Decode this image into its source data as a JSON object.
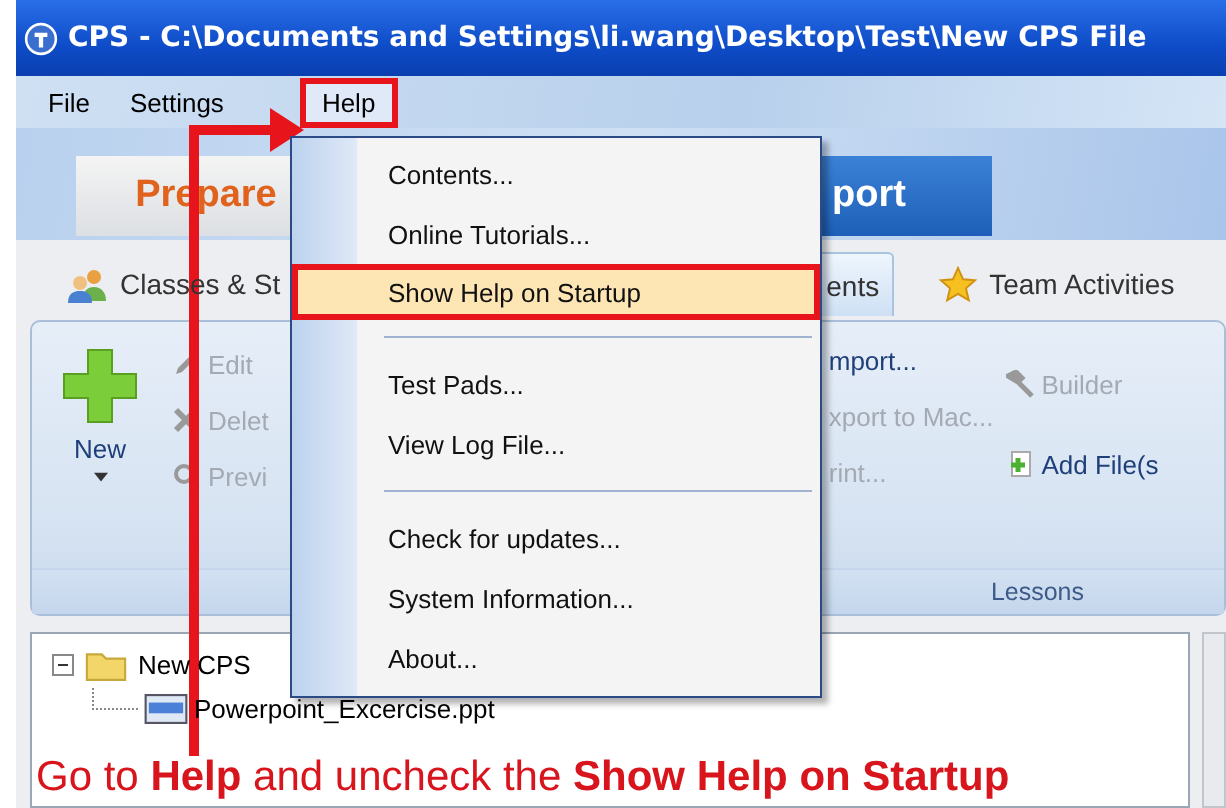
{
  "window": {
    "title": "CPS - C:\\Documents and Settings\\li.wang\\Desktop\\Test\\New CPS File"
  },
  "menu_bar": [
    {
      "label": "File",
      "selected": false
    },
    {
      "label": "Settings",
      "selected": false
    },
    {
      "label": "Help",
      "selected": true
    }
  ],
  "help_menu": [
    {
      "kind": "item",
      "label": "Contents...",
      "selected": false
    },
    {
      "kind": "item",
      "label": "Online Tutorials...",
      "selected": false
    },
    {
      "kind": "item",
      "label": "Show Help on Startup",
      "selected": true
    },
    {
      "kind": "separator"
    },
    {
      "kind": "item",
      "label": "Test Pads...",
      "selected": false
    },
    {
      "kind": "item",
      "label": "View Log File...",
      "selected": false
    },
    {
      "kind": "separator"
    },
    {
      "kind": "item",
      "label": "Check for updates...",
      "selected": false
    },
    {
      "kind": "item",
      "label": "System Information...",
      "selected": false
    },
    {
      "kind": "item",
      "label": "About...",
      "selected": false
    }
  ],
  "main_tabs": [
    {
      "label": "Prepare",
      "selected": true
    },
    {
      "label": "port",
      "selected": false
    }
  ],
  "sub_tabs": [
    {
      "label": "Classes & St",
      "selected": false
    },
    {
      "label": "ents",
      "selected": true
    },
    {
      "label": "Team Activities",
      "selected": false
    }
  ],
  "ribbon": {
    "new_button": "New",
    "left_actions": [
      {
        "label": "Edit",
        "disabled": true
      },
      {
        "label": "Delet",
        "disabled": true
      },
      {
        "label": "Previ",
        "disabled": true
      }
    ],
    "middle_actions": [
      {
        "label": "mport...",
        "disabled": false
      },
      {
        "label": "xport to Mac...",
        "disabled": true
      },
      {
        "label": "rint...",
        "disabled": true
      }
    ],
    "right_actions": [
      {
        "label": "Builder",
        "disabled": true
      },
      {
        "label": "Add File(s",
        "disabled": false
      }
    ],
    "group_label": "Lessons"
  },
  "tree": [
    {
      "label": "New CPS",
      "expanded": true,
      "children": [
        {
          "label": "Powerpoint_Excercise.ppt"
        }
      ]
    }
  ],
  "annotation": "Go to **Help** and uncheck the **Show Help on Startup**"
}
